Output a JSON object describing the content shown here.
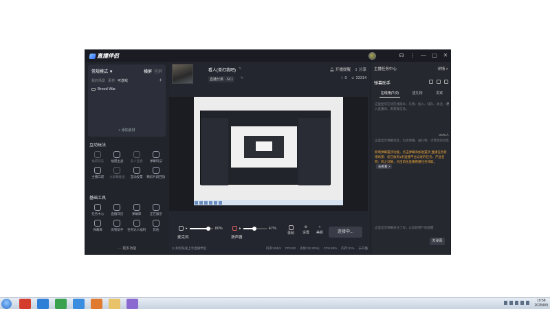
{
  "app": {
    "logo_text": "直播伴侣",
    "window_buttons": [
      "headset-icon",
      "menu-icon",
      "minimize-icon",
      "maximize-icon",
      "close-icon"
    ]
  },
  "scene": {
    "mode_label": "常规模式 ▼",
    "tabs": [
      {
        "label": "横屏",
        "active": true
      },
      {
        "label": "竖屏",
        "active": false
      }
    ],
    "source_tabs": [
      {
        "label": "我的场景",
        "active": false
      },
      {
        "label": "素材",
        "active": false
      },
      {
        "label": "可游戏",
        "active": true
      }
    ],
    "add_icon": "+",
    "source_item": "Brood War",
    "add_source": "+ 添加素材"
  },
  "interactive": {
    "title": "互动玩法",
    "tools": [
      {
        "label": "福袋玩法",
        "icon": "gift-icon",
        "dim": true
      },
      {
        "label": "福盟主战",
        "icon": "shield-icon",
        "dim": false
      },
      {
        "label": "多人连麦",
        "icon": "multi-user-icon",
        "dim": true
      },
      {
        "label": "弹幕玩法",
        "icon": "download-icon",
        "dim": false
      },
      {
        "label": "主播口袋",
        "icon": "bag-icon",
        "dim": false
      },
      {
        "label": "大屏幕推送",
        "icon": "screen-icon",
        "dim": true
      },
      {
        "label": "互动投票",
        "icon": "vote-icon",
        "dim": false
      },
      {
        "label": "精彩片段回放",
        "icon": "replay-icon",
        "dim": false
      }
    ]
  },
  "basic": {
    "title": "基础工具",
    "tools": [
      {
        "label": "任务中心",
        "icon": "task-icon"
      },
      {
        "label": "直播日历",
        "icon": "calendar-icon"
      },
      {
        "label": "弹幕库",
        "icon": "danmu-icon"
      },
      {
        "label": "正在展示",
        "icon": "display-icon"
      },
      {
        "label": "弹幕库",
        "icon": "chat-icon"
      },
      {
        "label": "房管助手",
        "icon": "house-icon"
      },
      {
        "label": "任务达人福利",
        "icon": "reward-icon"
      },
      {
        "label": "其他",
        "icon": "smile-icon"
      }
    ],
    "more": "··· 更多功能"
  },
  "room": {
    "title": "看人(单打我吧)",
    "category": "直播分类 · SC1",
    "links": [
      "开播提醒",
      "分享"
    ],
    "likes": "0",
    "viewers": "23314"
  },
  "controls": {
    "mic_label": "麦克风",
    "mic_percent": "80%",
    "mic_level": 0.8,
    "speaker_label": "扬声器",
    "speaker_percent": "47%",
    "speaker_level": 0.47,
    "record_label": "录制",
    "settings_label": "设置",
    "beauty_label": "美颜",
    "go_live": "连接中..."
  },
  "status": {
    "help": "如何快速上手直播伴侣",
    "metrics": [
      "码率:0Kb/s",
      "FPS:60",
      "丢帧:0(0.00%)",
      "CPU:48%",
      "内存:31%",
      "未开播"
    ]
  },
  "right": {
    "task_center": "主播任务中心",
    "task_more": "详情 >",
    "assistant_title": "弹幕助手",
    "tabs": [
      {
        "label": "在线用户(0)",
        "active": true
      },
      {
        "label": "送礼物",
        "active": false
      },
      {
        "label": "贵宾",
        "active": false
      }
    ],
    "tip1": "这里显示在场在线观众、礼物、加入、排队、关注、进入直播间、贵宾等信息。",
    "count": "0",
    "counter": "0/0/0人",
    "tip2": "这里显示弹幕消息，包含弹幕、送礼物、点赞等的消息",
    "orange": "新增弹幕置顶功能，点击弹幕添加进置顶 直播任务新增场景：您已收到1条直播平台派发的任务，产品名称：风之剑舞，点击前往直播看播任务领取。",
    "go_button": "去看看 >",
    "input_hint": "这里显示弹幕关注了你，以及新用户的提醒",
    "send": "发弹幕"
  },
  "taskbar": {
    "time": "19:58",
    "date": "2025/8/9"
  },
  "colors": {
    "app_bg": "#24262f",
    "panel_bg": "#2c2f3a",
    "accent_orange": "#e9a43b"
  }
}
